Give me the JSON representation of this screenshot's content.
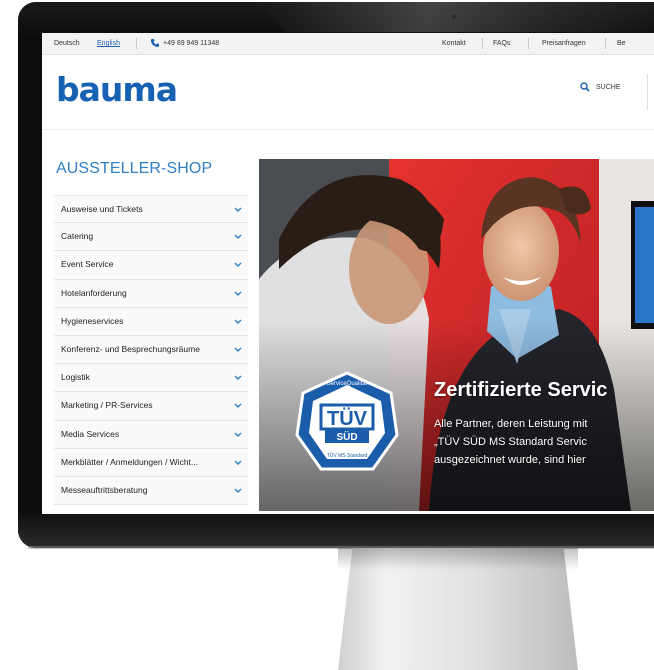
{
  "topbar": {
    "lang_de": "Deutsch",
    "lang_en": "English",
    "phone": "+49 89 949 11348",
    "nav": [
      "Kontakt",
      "FAQs",
      "Preisanfragen",
      "Be"
    ]
  },
  "header": {
    "logo": "bauma",
    "search_label": "SUCHE"
  },
  "sidebar": {
    "heading": "AUSSTELLER-SHOP",
    "items": [
      {
        "label": "Ausweise und Tickets"
      },
      {
        "label": "Catering"
      },
      {
        "label": "Event Service"
      },
      {
        "label": "Hotelanforderung"
      },
      {
        "label": "Hygieneservices"
      },
      {
        "label": "Konferenz- und Besprechungsräume"
      },
      {
        "label": "Logistik"
      },
      {
        "label": "Marketing / PR-Services"
      },
      {
        "label": "Media Services"
      },
      {
        "label": "Merkblätter / Anmeldungen / Wicht..."
      },
      {
        "label": "Messeauftrittsberatung"
      }
    ]
  },
  "hero": {
    "title": "Zertifizierte Servic",
    "line1": "Alle Partner, deren Leistung mit",
    "line2": "„TÜV SÜD MS Standard Servic",
    "line3": "ausgezeichnet wurde, sind hier",
    "badge": {
      "top": "ServiceQualität",
      "main": "TÜV",
      "sub": "SÜD",
      "bottom": "TÜV MS Standard"
    }
  },
  "colors": {
    "brand_blue": "#1761b3",
    "link_blue": "#2f7fc4",
    "hero_red": "#d8262b"
  }
}
